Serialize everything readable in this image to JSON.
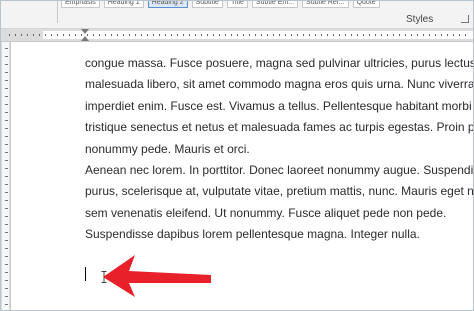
{
  "ribbon": {
    "style_gallery": [
      "Emphasis",
      "Heading 1",
      "Heading 2",
      "Subtitle",
      "Title",
      "Subtle Em...",
      "Subtle Ref...",
      "Quote"
    ],
    "selected_index": 2,
    "group_label": "Styles"
  },
  "document": {
    "lines": [
      "congue massa. Fusce posuere, magna sed pulvinar ultricies, purus lectus",
      "malesuada libero, sit amet commodo magna eros quis urna. Nunc viverra",
      "imperdiet enim. Fusce est. Vivamus a tellus. Pellentesque habitant morbi",
      "tristique senectus et netus et malesuada fames ac turpis egestas. Proin pharetra",
      "nonummy pede. Mauris et orci.",
      "Aenean nec lorem. In porttitor. Donec laoreet nonummy augue. Suspendisse dui",
      "purus, scelerisque at, vulputate vitae, pretium mattis, nunc. Mauris eget neque at",
      "sem venenatis eleifend. Ut nonummy. Fusce aliquet pede non pede.",
      "Suspendisse dapibus lorem pellentesque magna. Integer nulla."
    ]
  },
  "annotation": {
    "arrow_color": "#e8202a",
    "caret_icon": "text-cursor-icon",
    "pointer_icon": "i-beam-cursor-icon"
  },
  "colors": {
    "ribbon_bg": "#f3f3f3",
    "ruler_bg": "#dcdcdc",
    "text": "#2b2b2b"
  }
}
